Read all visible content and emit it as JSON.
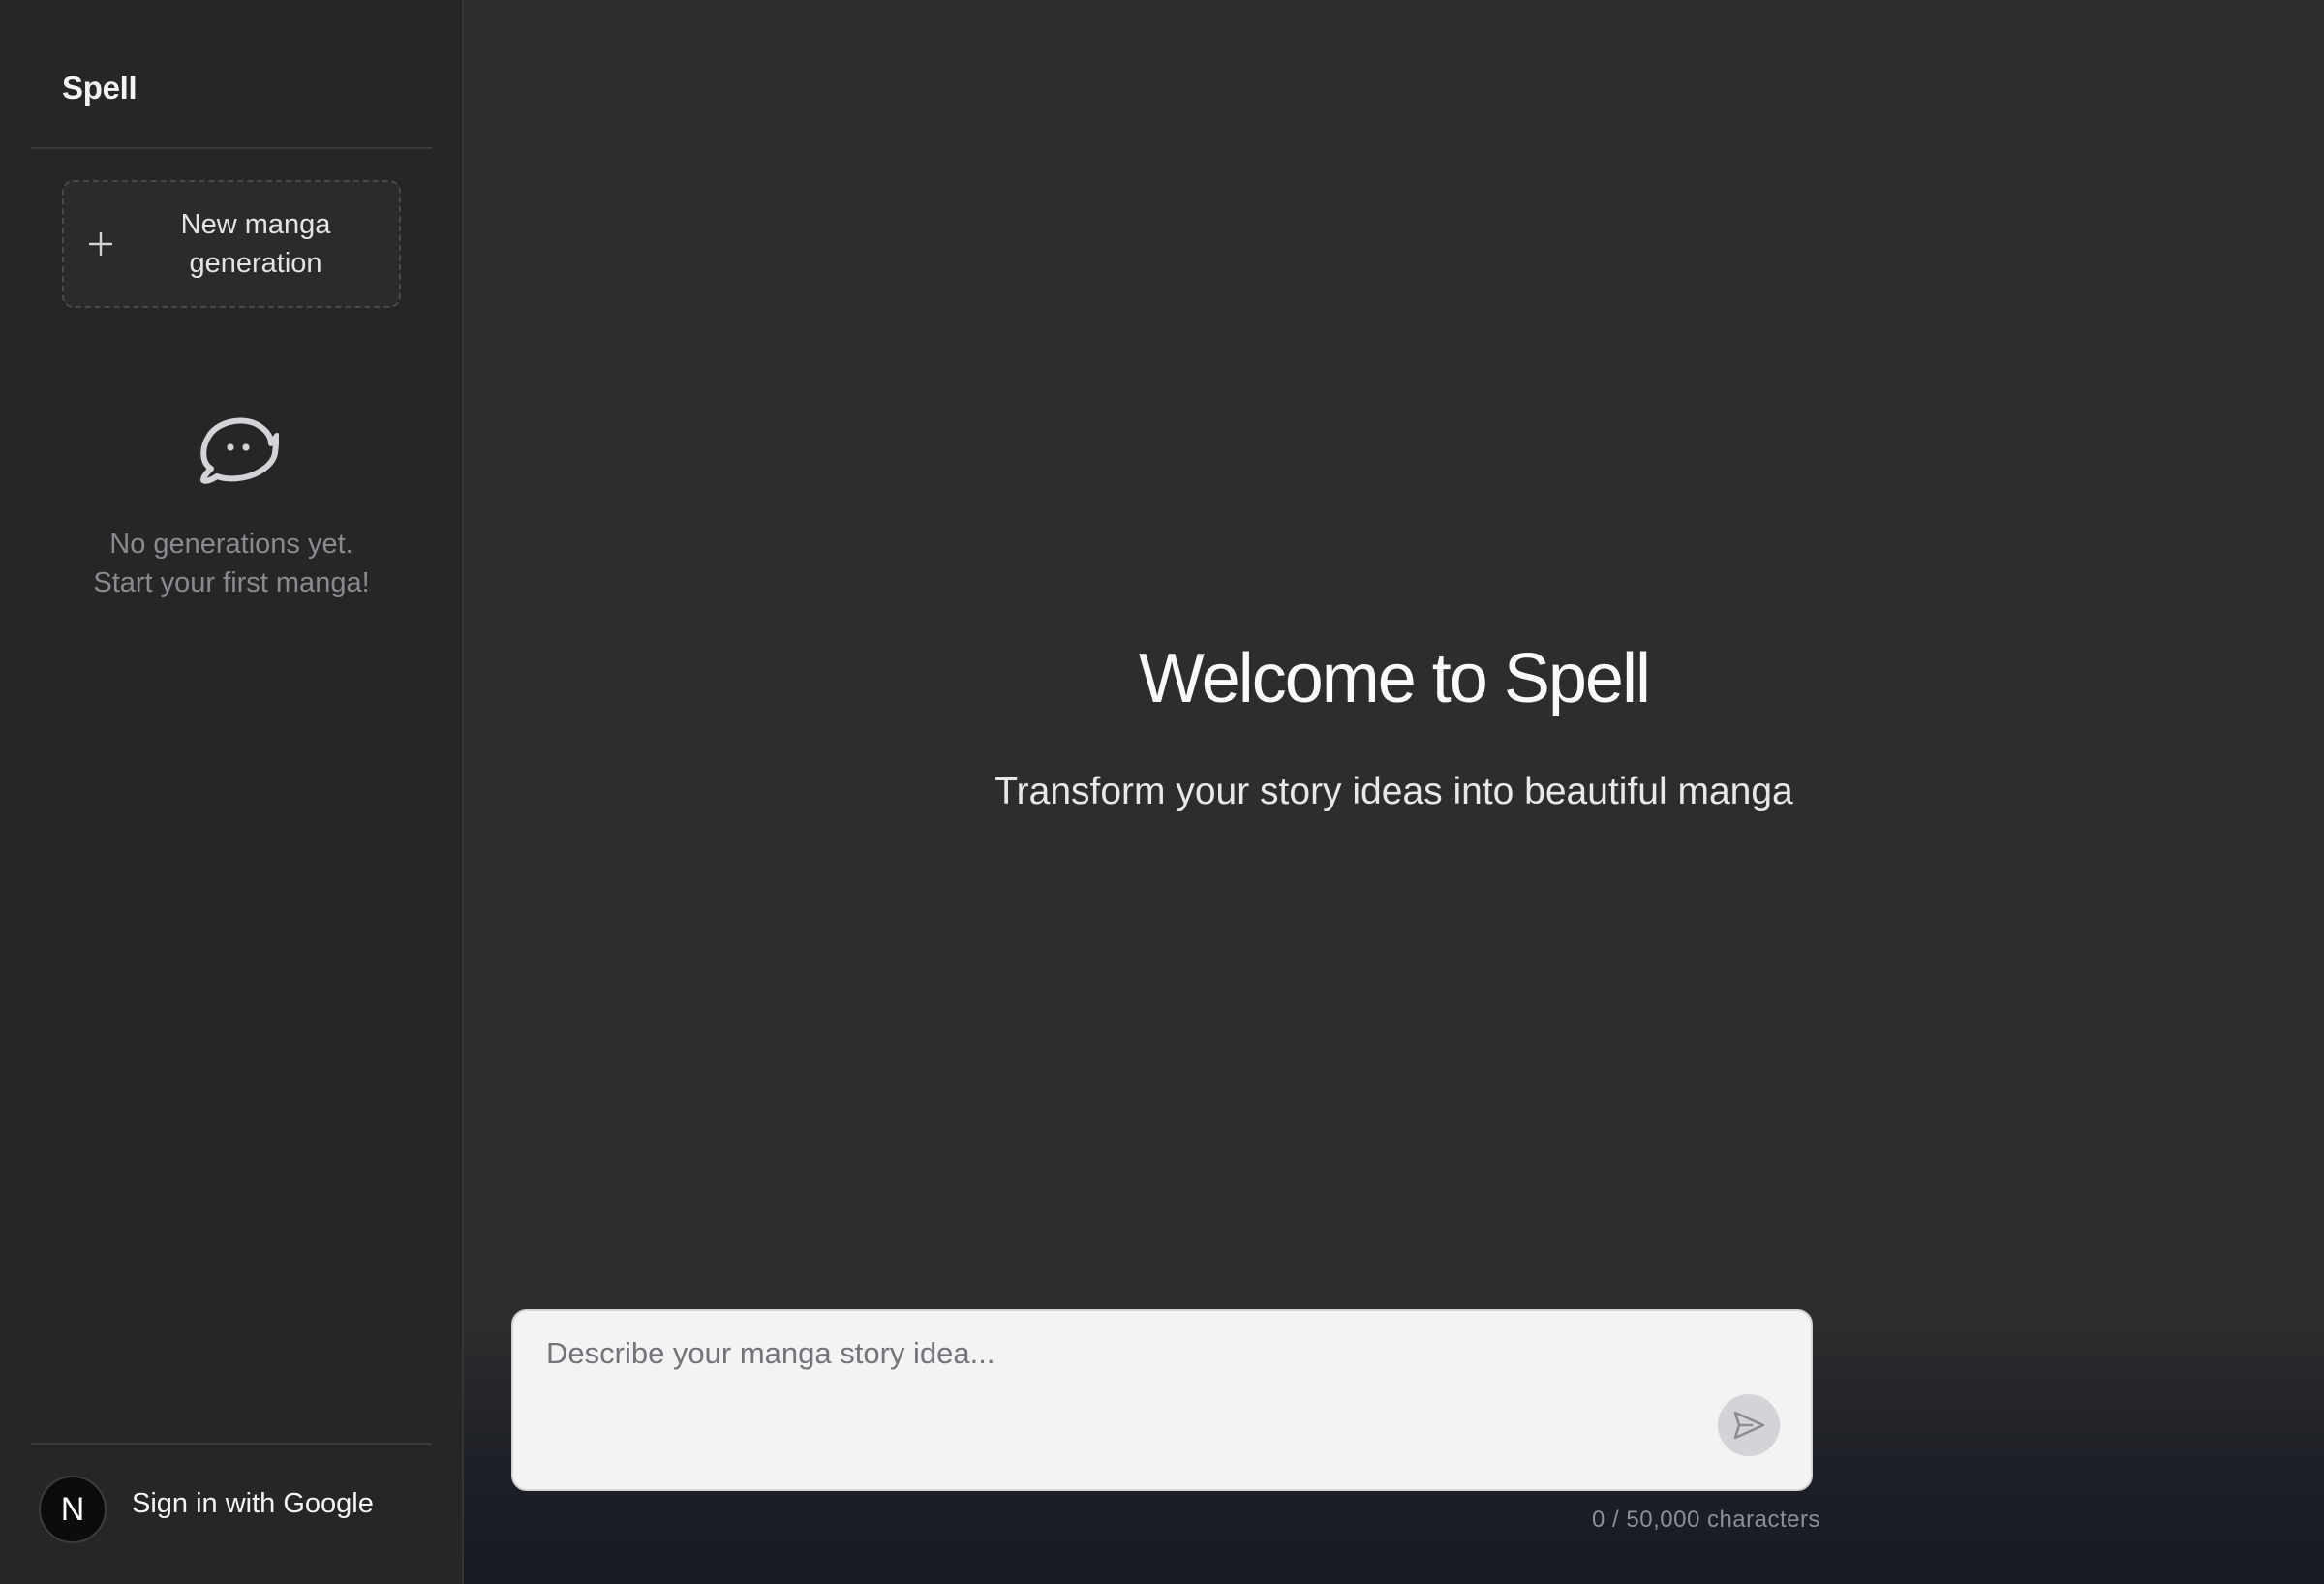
{
  "app": {
    "brand": "Spell"
  },
  "sidebar": {
    "new_button_label": "New manga generation",
    "new_button_icon": "plus-icon",
    "empty_state": {
      "icon": "chat-bubble-face-icon",
      "line1": "No generations yet.",
      "line2": "Start your first manga!"
    },
    "account": {
      "avatar_letter": "N",
      "signin_label": "Sign in with Google"
    }
  },
  "main": {
    "title": "Welcome to Spell",
    "subtitle": "Transform your story ideas into beautiful manga",
    "composer": {
      "placeholder": "Describe your manga story idea...",
      "value": "",
      "send_icon": "send-icon",
      "char_count": "0 / 50,000 characters"
    }
  },
  "colors": {
    "sidebar_bg": "#262627",
    "main_bg": "#2d2d2e",
    "composer_bg": "#f3f3f3",
    "send_button_bg": "#d4d4d8",
    "muted_text": "#8a8a90"
  }
}
